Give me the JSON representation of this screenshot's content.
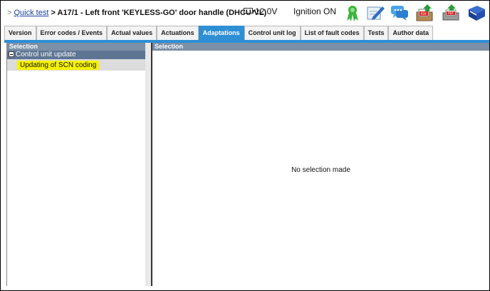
{
  "header": {
    "breadcrumb_sep": ">",
    "quick_test_link": "Quick test",
    "title": "> A17/1 - Left front 'KEYLESS-GO' door handle (DHCU-VL)",
    "voltage": "12.0V",
    "ignition": "Ignition ON"
  },
  "tabs": [
    {
      "label": "Version"
    },
    {
      "label": "Error codes / Events"
    },
    {
      "label": "Actual values"
    },
    {
      "label": "Actuations"
    },
    {
      "label": "Adaptations",
      "active": true
    },
    {
      "label": "Control unit log"
    },
    {
      "label": "List of fault codes"
    },
    {
      "label": "Tests"
    },
    {
      "label": "Author data"
    }
  ],
  "left_panel": {
    "header": "Selection",
    "tree": {
      "root_label": "Control unit update",
      "child_label": "Updating of SCN coding"
    }
  },
  "right_panel": {
    "header": "Selection",
    "empty_message": "No selection made"
  },
  "toolbar_icons": [
    "ribbon-icon",
    "edit-note-icon",
    "chat-icon",
    "pdf-upload-icon",
    "pdf-print-icon",
    "book-icon"
  ],
  "colors": {
    "accent_tab": "#2e8fd5",
    "panel_header": "#7b8fa6",
    "highlight": "#f6f200",
    "link": "#1b3fa0"
  }
}
